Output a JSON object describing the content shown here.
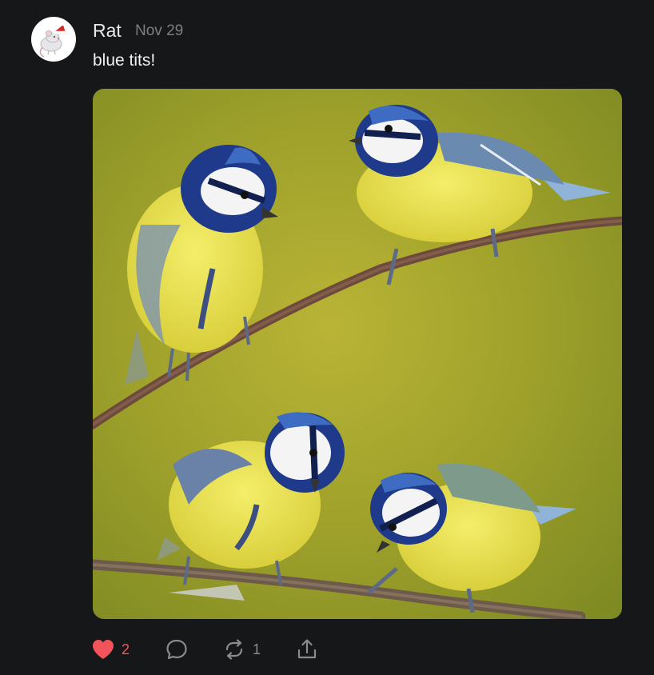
{
  "post": {
    "author": "Rat",
    "date": "Nov 29",
    "text": "blue tits!",
    "avatar_icon": "rat-with-santa-hat-icon",
    "image_description_icon": "blue-tits-on-branches-photo"
  },
  "actions": {
    "like_count": "2",
    "reply_count": "",
    "repost_count": "1",
    "like_icon": "heart-icon",
    "reply_icon": "comment-bubble-icon",
    "repost_icon": "repost-arrows-icon",
    "share_icon": "share-upload-icon"
  },
  "colors": {
    "background": "#161719",
    "text_primary": "#e9e9ea",
    "text_secondary": "#7d7e82",
    "like_active": "#f2545b"
  }
}
